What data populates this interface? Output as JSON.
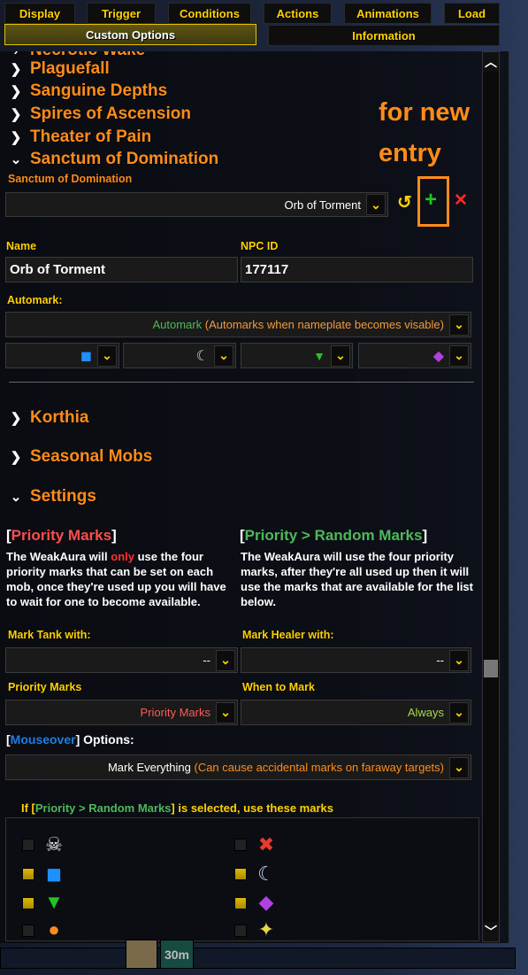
{
  "tabs": {
    "row1": [
      "Display",
      "Trigger",
      "Conditions",
      "Actions",
      "Animations",
      "Load"
    ],
    "row2": [
      "Custom Options",
      "Information"
    ],
    "selected": "Custom Options"
  },
  "tree": {
    "partial": "Necrotic Wake",
    "items": [
      "Plaguefall",
      "Sanguine Depths",
      "Spires of Ascension",
      "Theater of Pain",
      "Sanctum of Domination"
    ],
    "later": [
      "Korthia",
      "Seasonal Mobs",
      "Settings"
    ]
  },
  "annotation": {
    "line1": "for new",
    "line2": "entry",
    "color": "#ff8c1a"
  },
  "sanctum": {
    "label": "Sanctum of Domination",
    "selected": "Orb of Torment",
    "icons": [
      "undo-icon",
      "plus-icon",
      "delete-icon"
    ]
  },
  "entry": {
    "name_label": "Name",
    "name_value": "Orb of Torment",
    "npc_label": "NPC ID",
    "npc_value": "177117",
    "automark_label": "Automark:",
    "automark_value": "Automark",
    "automark_note": "(Automarks when nameplate becomes visable)",
    "marks": [
      "square",
      "moon",
      "triangle",
      "diamond"
    ]
  },
  "settings": {
    "priority_heading": "Priority Marks",
    "priority_text_pre": "The WeakAura will ",
    "priority_text_only": "only",
    "priority_text_post": " use the four priority marks that can be set on each mob, once they're used up you will have to wait for one to become available.",
    "random_heading": "Priority > Random Marks",
    "random_text": "The WeakAura will use the four priority marks, after they're all used up then it will use the marks that are available for the list below.",
    "tank_label": "Mark Tank with:",
    "tank_value": "--",
    "healer_label": "Mark Healer with:",
    "healer_value": "--",
    "pm_label": "Priority Marks",
    "pm_value": "Priority Marks",
    "when_label": "When to Mark",
    "when_value": "Always",
    "mouseover_word": "Mouseover",
    "mouseover_rest": " Options:",
    "mouseover_value": "Mark Everything",
    "mouseover_note": "(Can cause accidental marks on faraway targets)",
    "if_pre": "If [",
    "if_mid": "Priority > Random Marks",
    "if_post": "] is selected, use these marks",
    "marks": [
      {
        "icon": "skull",
        "checked": false
      },
      {
        "icon": "cross",
        "checked": false
      },
      {
        "icon": "square",
        "checked": true
      },
      {
        "icon": "moon",
        "checked": true
      },
      {
        "icon": "triangle",
        "checked": true
      },
      {
        "icon": "diamond",
        "checked": true
      },
      {
        "icon": "circle",
        "checked": false
      },
      {
        "icon": "star",
        "checked": false
      }
    ]
  },
  "bottom": {
    "timer": "30m"
  }
}
